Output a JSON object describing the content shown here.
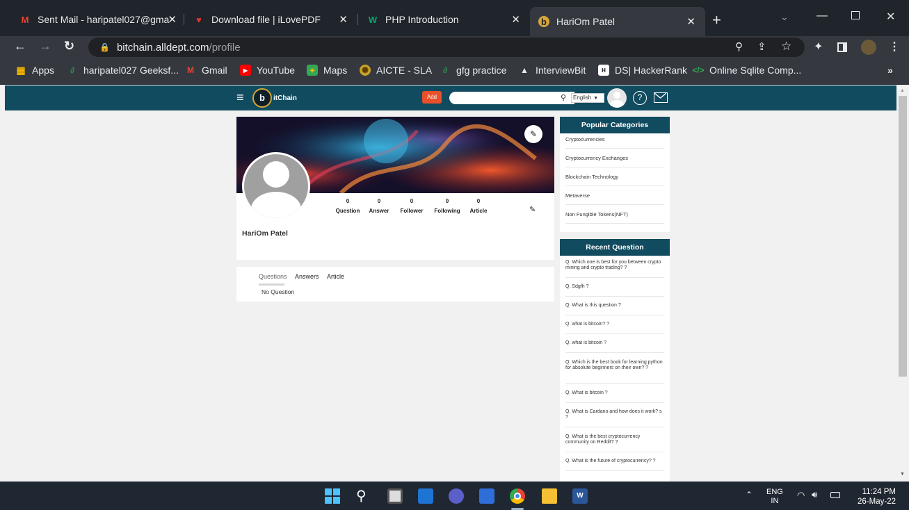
{
  "browser": {
    "tabs": [
      {
        "title": "Sent Mail - haripatel027@gma",
        "icon": "gmail-icon"
      },
      {
        "title": "Download file | iLovePDF",
        "icon": "ilovepdf-icon"
      },
      {
        "title": "PHP Introduction",
        "icon": "w3schools-icon"
      },
      {
        "title": "HariOm Patel",
        "icon": "bitchain-icon"
      }
    ],
    "url_host": "bitchain.alldept.com",
    "url_path": "/profile",
    "bookmarks": [
      {
        "label": "Apps",
        "icon": "apps-grid-icon"
      },
      {
        "label": "haripatel027 Geeksf...",
        "icon": "gfg-icon"
      },
      {
        "label": "Gmail",
        "icon": "gmail-icon"
      },
      {
        "label": "YouTube",
        "icon": "youtube-icon"
      },
      {
        "label": "Maps",
        "icon": "maps-icon"
      },
      {
        "label": "AICTE - SLA",
        "icon": "aicte-icon"
      },
      {
        "label": "gfg practice",
        "icon": "gfg-icon"
      },
      {
        "label": "InterviewBit",
        "icon": "interviewbit-icon"
      },
      {
        "label": "DS| HackerRank",
        "icon": "hackerrank-icon"
      },
      {
        "label": "Online Sqlite Comp...",
        "icon": "code-icon"
      }
    ],
    "more_bookmarks": "»"
  },
  "site": {
    "logo_text": "itChain",
    "add_label": "Add",
    "search_placeholder": "",
    "language": "English",
    "accent": "#114b5f",
    "add_color": "#e8502b"
  },
  "profile": {
    "name": "HariOm Patel",
    "stats": [
      {
        "label": "Question",
        "value": "0"
      },
      {
        "label": "Answer",
        "value": "0"
      },
      {
        "label": "Follower",
        "value": "0"
      },
      {
        "label": "Following",
        "value": "0"
      },
      {
        "label": "Article",
        "value": "0"
      }
    ],
    "tabs": [
      "Questions",
      "Answers",
      "Article"
    ],
    "empty_text": "No Question"
  },
  "categories": {
    "title": "Popular Categories",
    "items": [
      "Cryptocurrencies",
      "Cryptocurrency Exchanges",
      "Blockchain Technology",
      "Metaverse",
      "Non Fungible Tokens(NFT)"
    ]
  },
  "recent": {
    "title": "Recent Question",
    "items": [
      "Q. Which one is best for you between crypto mining and crypto trading? ?",
      "Q. Sdgfh ?",
      "Q. What is this question ?",
      "Q. what is bitcoin? ?",
      "Q. what is bitcoin ?",
      "Q. Which is the best book for learning python for absolute beginners on their own? ?",
      "Q. What is bitcoin ?",
      "Q. What is Cardano and how does it work? s ?",
      "Q. What is the best cryptocurrency community on Reddit? ?",
      "Q. What is the future of cryptocurrency? ?"
    ]
  },
  "taskbar": {
    "lang": "ENG",
    "region": "IN",
    "time": "11:24 PM",
    "date": "26-May-22"
  }
}
